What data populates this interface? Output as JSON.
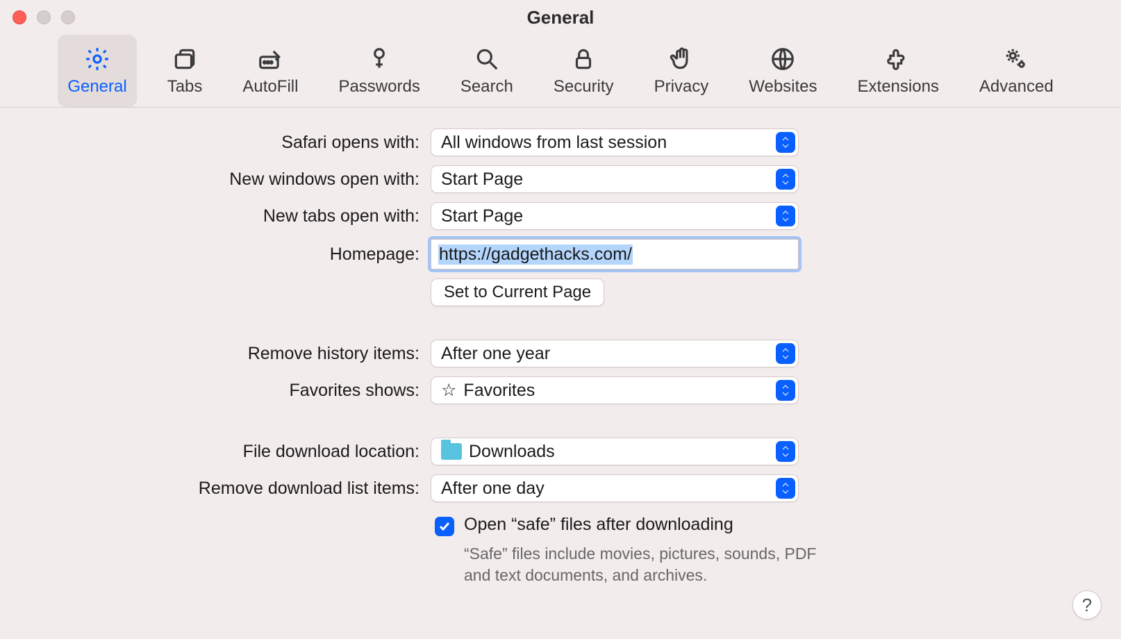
{
  "window": {
    "title": "General"
  },
  "toolbar": {
    "items": [
      {
        "id": "general",
        "label": "General"
      },
      {
        "id": "tabs",
        "label": "Tabs"
      },
      {
        "id": "autofill",
        "label": "AutoFill"
      },
      {
        "id": "passwords",
        "label": "Passwords"
      },
      {
        "id": "search",
        "label": "Search"
      },
      {
        "id": "security",
        "label": "Security"
      },
      {
        "id": "privacy",
        "label": "Privacy"
      },
      {
        "id": "websites",
        "label": "Websites"
      },
      {
        "id": "extensions",
        "label": "Extensions"
      },
      {
        "id": "advanced",
        "label": "Advanced"
      }
    ]
  },
  "labels": {
    "opens_with": "Safari opens with:",
    "new_windows": "New windows open with:",
    "new_tabs": "New tabs open with:",
    "homepage": "Homepage:",
    "set_current": "Set to Current Page",
    "remove_history": "Remove history items:",
    "favorites_shows": "Favorites shows:",
    "download_location": "File download location:",
    "remove_downloads": "Remove download list items:",
    "open_safe": "Open “safe” files after downloading",
    "safe_desc": "“Safe” files include movies, pictures, sounds, PDF and text documents, and archives.",
    "help": "?"
  },
  "values": {
    "opens_with": "All windows from last session",
    "new_windows": "Start Page",
    "new_tabs": "Start Page",
    "homepage": "https://gadgethacks.com/",
    "remove_history": "After one year",
    "favorites_shows": "Favorites",
    "download_location": "Downloads",
    "remove_downloads": "After one day",
    "open_safe_checked": true
  }
}
